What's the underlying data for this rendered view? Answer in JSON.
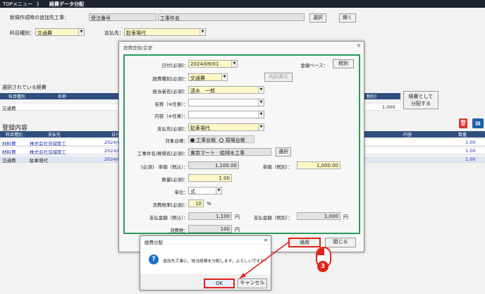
{
  "topbar": {
    "menu": "TOPメニュー",
    "sep": "》",
    "title": "経費データ分配"
  },
  "header": {
    "target_label": "新規作成時の追加先工事：",
    "order_no_label": "受注番号",
    "work_name_label": "工事件名",
    "select_btn": "選択",
    "open_btn": "開く",
    "category_label": "科目種別：",
    "category_value": "交通費",
    "payee_label": "支払先：",
    "payee_value": "駐車場代"
  },
  "selected_section": {
    "title": "選択されている経費",
    "col_category": "科目種別",
    "col_name": "名称",
    "col_right": "税別）",
    "row_category": "交通費",
    "row_amount": "1,000",
    "distribute_btn_l1": "経費として",
    "distribute_btn_l2": "分配する"
  },
  "registered_section": {
    "title": "登録内容",
    "headers": [
      "科目種別",
      "支払先",
      "日付",
      "内容",
      "数量"
    ],
    "rows": [
      {
        "category": "材料費",
        "payee": "株式会社茨城管工",
        "date": "2024/0",
        "qty": "1.00"
      },
      {
        "category": "材料費",
        "payee": "株式会社茨城管工",
        "date": "2024/0",
        "qty": "1.00"
      },
      {
        "category": "交通費",
        "payee": "駐車場代",
        "date": "2024/0",
        "qty": "1.00"
      }
    ]
  },
  "form_dialog": {
    "title": "経費登録/変更",
    "close": "✕",
    "date_label": "日付[必須]：",
    "date_value": "2024/09/01",
    "amount_base_label": "金額ベース：",
    "amount_base_btn": "税別",
    "category_label": "経費種別[必須]：",
    "category_value": "交通費",
    "detail_btn": "内訳表示",
    "staff_label": "担当者名[必須]：",
    "staff_value": "清水　一郎",
    "name_label": "名称（※任意）：",
    "content_label": "内容（※任意）：",
    "payee_label": "支払先[必須]：",
    "payee_value": "駐車場代",
    "ledger_label": "対象台帳：",
    "ledger_opt1": "工事台帳",
    "ledger_opt2": "現場台帳",
    "work_label": "工事件名/現場名[必須]：",
    "work_value": "東京マート　給排水工事",
    "work_select_btn": "選択",
    "unit_price_incl_label": "[必須]　単価（税込）：",
    "unit_price_incl_value": "1,100.00",
    "unit_price_excl_label": "単価（税別）：",
    "unit_price_excl_value": "1,000.00",
    "qty_label": "数量[必須]：",
    "qty_value": "1.00",
    "unit_label": "単位：",
    "unit_value": "式",
    "tax_rate_label": "消費税率[必須]：",
    "tax_rate_value": "10",
    "tax_rate_unit": "%",
    "pay_incl_label": "支払金額（税込）：",
    "pay_incl_value": "1,100",
    "yen1": "円",
    "pay_excl_label": "支払金額（税別）：",
    "pay_excl_value": "1,000",
    "yen2": "円",
    "tax_label": "消費税：",
    "tax_value": "100",
    "yen3": "円",
    "apply_btn": "適用",
    "close_btn": "閉じる"
  },
  "confirm_dialog": {
    "title": "経費分配",
    "close": "✕",
    "message": "追加先工事に、該当経費を分配します。よろしいですか？",
    "ok_btn": "OK",
    "cancel_btn": "キャンセル"
  },
  "annotation": {
    "step_number": "3"
  },
  "colors": {
    "accent_red": "#e0241b",
    "frame_green": "#2c9a5a",
    "header_navy": "#2f4f7f"
  }
}
